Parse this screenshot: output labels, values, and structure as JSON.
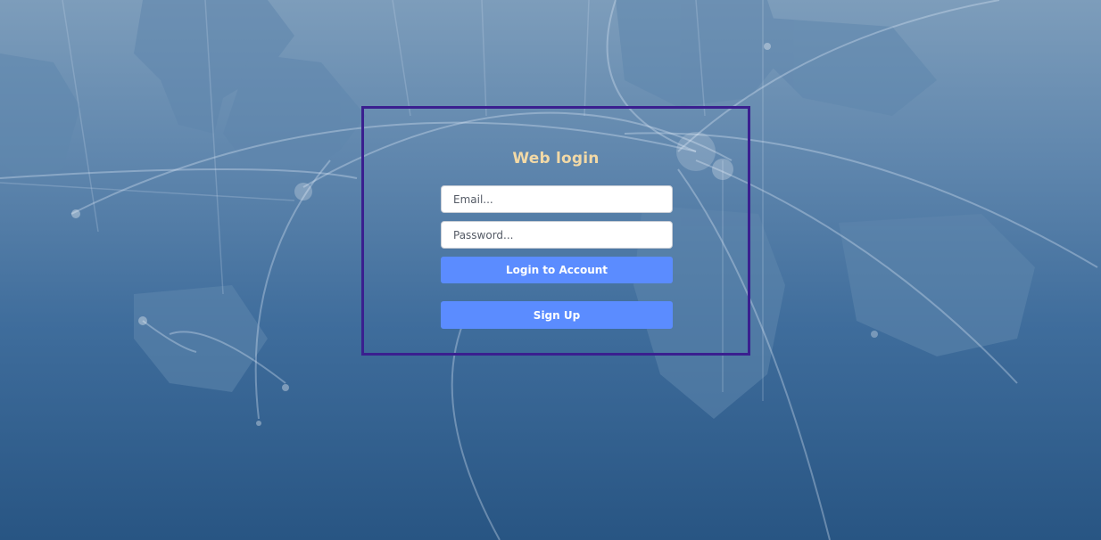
{
  "login": {
    "title": "Web login",
    "email_placeholder": "Email...",
    "password_placeholder": "Password...",
    "login_label": "Login to Account",
    "signup_label": "Sign Up"
  },
  "colors": {
    "title": "#f2d9a6",
    "button": "#5b8cff",
    "frame_border": "#3a1f8f"
  }
}
